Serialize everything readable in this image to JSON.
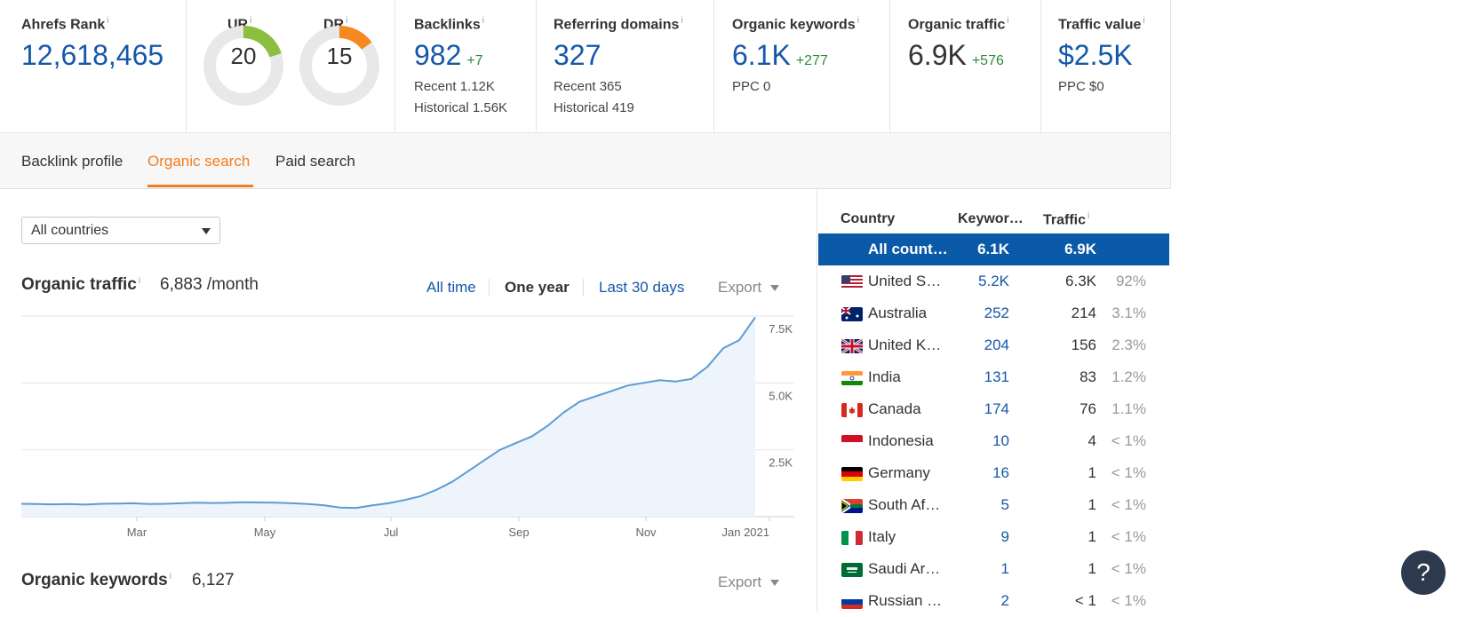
{
  "metrics": {
    "ahrefs_rank": {
      "label": "Ahrefs Rank",
      "value": "12,618,465"
    },
    "ur": {
      "label": "UR",
      "value": "20",
      "score": 20,
      "color": "#8cbf3f"
    },
    "dr": {
      "label": "DR",
      "value": "15",
      "score": 15,
      "color": "#f5891f"
    },
    "backlinks": {
      "label": "Backlinks",
      "value": "982",
      "delta": "+7",
      "recent": "Recent 1.12K",
      "historical": "Historical 1.56K"
    },
    "referring_domains": {
      "label": "Referring domains",
      "value": "327",
      "recent": "Recent 365",
      "historical": "Historical 419"
    },
    "organic_keywords": {
      "label": "Organic keywords",
      "value": "6.1K",
      "delta": "+277",
      "ppc": "PPC 0"
    },
    "organic_traffic": {
      "label": "Organic traffic",
      "value": "6.9K",
      "delta": "+576"
    },
    "traffic_value": {
      "label": "Traffic value",
      "value": "$2.5K",
      "ppc": "PPC $0"
    },
    "info_mark": "i"
  },
  "tabs": [
    {
      "label": "Backlink profile",
      "active": false
    },
    {
      "label": "Organic search",
      "active": true
    },
    {
      "label": "Paid search",
      "active": false
    }
  ],
  "country_select": {
    "value": "All countries"
  },
  "organic_traffic_section": {
    "title": "Organic traffic",
    "value": "6,883 /month",
    "ranges": [
      "All time",
      "One year",
      "Last 30 days"
    ],
    "selected_range": "One year",
    "export_label": "Export"
  },
  "organic_keywords_section": {
    "title": "Organic keywords",
    "value": "6,127",
    "export_label": "Export"
  },
  "chart_data": {
    "type": "area",
    "title": "",
    "xlabel": "",
    "ylabel": "",
    "x_ticks": [
      "Mar",
      "May",
      "Jul",
      "Sep",
      "Nov",
      "Jan 2021"
    ],
    "y_ticks": [
      "2.5K",
      "5.0K",
      "7.5K"
    ],
    "ylim": [
      0,
      7500
    ],
    "grid": true,
    "color": "#5b9bd5",
    "series": [
      {
        "values": [
          480,
          470,
          460,
          470,
          450,
          480,
          490,
          500,
          470,
          480,
          500,
          520,
          510,
          520,
          540,
          530,
          520,
          500,
          470,
          420,
          340,
          330,
          420,
          500,
          620,
          760,
          1000,
          1300,
          1700,
          2100,
          2500,
          2750,
          3000,
          3400,
          3900,
          4300,
          4500,
          4700,
          4900,
          5000,
          5100,
          5050,
          5150,
          5600,
          6300,
          6600,
          7450
        ]
      }
    ]
  },
  "country_table": {
    "headers": {
      "country": "Country",
      "keywords": "Keywor…",
      "traffic": "Traffic"
    },
    "rows": [
      {
        "name": "All count…",
        "keywords": "6.1K",
        "traffic": "6.9K",
        "share": "",
        "flag": "none",
        "selected": true
      },
      {
        "name": "United S…",
        "keywords": "5.2K",
        "traffic": "6.3K",
        "share": "92%",
        "flag": "us"
      },
      {
        "name": "Australia",
        "keywords": "252",
        "traffic": "214",
        "share": "3.1%",
        "flag": "au"
      },
      {
        "name": "United K…",
        "keywords": "204",
        "traffic": "156",
        "share": "2.3%",
        "flag": "gb"
      },
      {
        "name": "India",
        "keywords": "131",
        "traffic": "83",
        "share": "1.2%",
        "flag": "in"
      },
      {
        "name": "Canada",
        "keywords": "174",
        "traffic": "76",
        "share": "1.1%",
        "flag": "ca"
      },
      {
        "name": "Indonesia",
        "keywords": "10",
        "traffic": "4",
        "share": "< 1%",
        "flag": "id"
      },
      {
        "name": "Germany",
        "keywords": "16",
        "traffic": "1",
        "share": "< 1%",
        "flag": "de"
      },
      {
        "name": "South Af…",
        "keywords": "5",
        "traffic": "1",
        "share": "< 1%",
        "flag": "za"
      },
      {
        "name": "Italy",
        "keywords": "9",
        "traffic": "1",
        "share": "< 1%",
        "flag": "it"
      },
      {
        "name": "Saudi Ar…",
        "keywords": "1",
        "traffic": "1",
        "share": "< 1%",
        "flag": "sa"
      },
      {
        "name": "Russian …",
        "keywords": "2",
        "traffic": "< 1",
        "share": "< 1%",
        "flag": "ru"
      }
    ]
  },
  "help_button": {
    "label": "?"
  }
}
